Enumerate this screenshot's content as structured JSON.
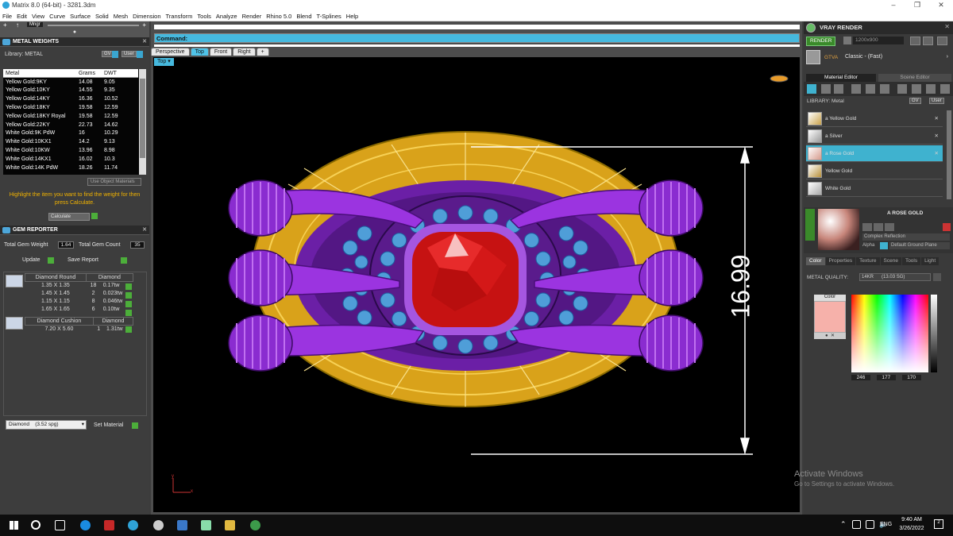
{
  "window": {
    "title": "Matrix 8.0 (64-bit) - 3281.3dm"
  },
  "menu": [
    "File",
    "Edit",
    "View",
    "Curve",
    "Surface",
    "Solid",
    "Mesh",
    "Dimension",
    "Transform",
    "Tools",
    "Analyze",
    "Render",
    "Rhino 5.0",
    "Blend",
    "T-Splines",
    "Help"
  ],
  "toolstrip": {
    "mngr": "Mngr"
  },
  "metal_weights": {
    "title": "METAL WEIGHTS",
    "library_label": "Library: METAL",
    "btn_gv": "GV",
    "btn_user": "User",
    "columns": [
      "Metal",
      "Grams",
      "DWT"
    ],
    "rows": [
      [
        "Yellow Gold:9KY",
        "14.08",
        "9.05"
      ],
      [
        "Yellow Gold:10KY",
        "14.55",
        "9.35"
      ],
      [
        "Yellow Gold:14KY",
        "16.36",
        "10.52"
      ],
      [
        "Yellow Gold:18KY",
        "19.58",
        "12.59"
      ],
      [
        "Yellow Gold:18KY Royal",
        "19.58",
        "12.59"
      ],
      [
        "Yellow Gold:22KY",
        "22.73",
        "14.62"
      ],
      [
        "White Gold:9K PdW",
        "16",
        "10.29"
      ],
      [
        "White Gold:10KX1",
        "14.2",
        "9.13"
      ],
      [
        "White Gold:10KW",
        "13.96",
        "8.98"
      ],
      [
        "White Gold:14KX1",
        "16.02",
        "10.3"
      ],
      [
        "White Gold:14K PdW",
        "18.26",
        "11.74"
      ]
    ],
    "use_object_materials": "Use Object Materials",
    "hint": "Highlight the item you want to find the weight for then press Calculate.",
    "calculate": "Calculate"
  },
  "gem_reporter": {
    "title": "GEM REPORTER",
    "total_gem_weight_label": "Total Gem Weight",
    "total_gem_weight": "1.64",
    "total_gem_count_label": "Total Gem Count",
    "total_gem_count": "35",
    "update": "Update",
    "save_report": "Save Report",
    "groups": [
      {
        "name": "Diamond Round",
        "material": "Diamond",
        "rows": [
          [
            "1.35 X 1.35",
            "18",
            "0.17tw"
          ],
          [
            "1.45 X 1.45",
            "2",
            "0.023tw"
          ],
          [
            "1.15 X 1.15",
            "8",
            "0.046tw"
          ],
          [
            "1.65 X 1.65",
            "6",
            "0.10tw"
          ]
        ]
      },
      {
        "name": "Diamond Cushion",
        "material": "Diamond",
        "rows": [
          [
            "7.20 X 5.60",
            "1",
            "1.31tw"
          ]
        ]
      }
    ],
    "material_select": "Diamond",
    "material_sg": "(3.52 spg)",
    "set_material": "Set Material"
  },
  "command": {
    "label": "Command:",
    "value": ""
  },
  "viewport_tabs": [
    "Perspective",
    "Top",
    "Front",
    "Right"
  ],
  "active_tab": "Top",
  "viewport_name": "Top",
  "dimension": "16.99",
  "axis": {
    "y": "y",
    "x": "x"
  },
  "watermark": {
    "title": "Activate Windows",
    "subtitle": "Go to Settings to activate Windows."
  },
  "vray": {
    "title": "VRAY RENDER",
    "render": "RENDER",
    "resolution": "1200x900",
    "preset_label": "GTVA",
    "preset": "Classic - (Fast)",
    "tab_material_editor": "Material Editor",
    "tab_scene_editor": "Scene Editor",
    "library_label": "LIBRARY: Metal",
    "btn_gv": "GV",
    "btn_user": "User",
    "materials": [
      "a Yellow Gold",
      "a Silver",
      "a Rose Gold",
      "Yellow Gold",
      "White Gold"
    ],
    "selected_material": "a Rose Gold",
    "current_material_name": "A ROSE GOLD",
    "complex_reflection": "Complex Reflection",
    "alpha": "Alpha",
    "ground_plane": "Default Ground Plane",
    "subtabs": [
      "Color",
      "Properties",
      "Texture",
      "Scene",
      "Tools",
      "Light"
    ],
    "metal_quality_label": "METAL QUALITY:",
    "metal_quality": "14KR",
    "metal_quality_sg": "(13.03 SG)",
    "color_label": "Color",
    "color_hex": "#f6b1aa",
    "rgb": [
      "246",
      "177",
      "170"
    ]
  },
  "taskbar": {
    "time": "9:40 AM",
    "date": "3/26/2022",
    "lang": "ENG",
    "notif": "2"
  }
}
